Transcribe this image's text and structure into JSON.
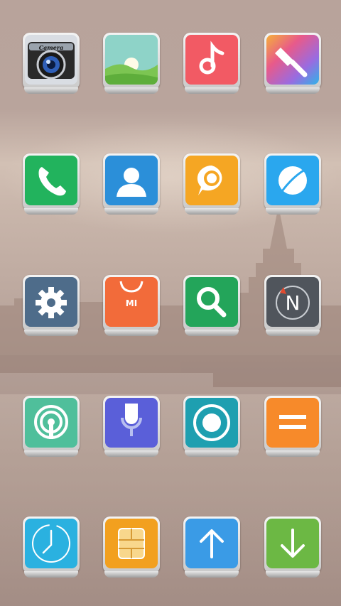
{
  "screen": {
    "apps": [
      {
        "icon": "camera-icon",
        "brand_text": "Camera",
        "color": "#2a2a2a"
      },
      {
        "icon": "gallery-icon",
        "color": "#8ed3c8"
      },
      {
        "icon": "music-icon",
        "color": "#f25a64"
      },
      {
        "icon": "themes-icon",
        "color": "#d46ad0"
      },
      {
        "icon": "phone-icon",
        "color": "#22b35d"
      },
      {
        "icon": "contacts-icon",
        "color": "#2b8fd9"
      },
      {
        "icon": "messages-icon",
        "color": "#f5a623"
      },
      {
        "icon": "browser-icon",
        "color": "#2aa7ee"
      },
      {
        "icon": "settings-icon",
        "color": "#4e6c8a"
      },
      {
        "icon": "mi-store-icon",
        "brand_text": "MI",
        "color": "#f26b3a"
      },
      {
        "icon": "search-icon",
        "color": "#23a55a"
      },
      {
        "icon": "compass-icon",
        "letter": "N",
        "color": "#50555c"
      },
      {
        "icon": "hotspot-icon",
        "color": "#4fbf9b"
      },
      {
        "icon": "voice-recorder-icon",
        "color": "#5a5fd9"
      },
      {
        "icon": "screen-recorder-icon",
        "color": "#1e9fb0"
      },
      {
        "icon": "calculator-icon",
        "color": "#f78a2a"
      },
      {
        "icon": "clock-icon",
        "color": "#2ab1e0"
      },
      {
        "icon": "sim-toolkit-icon",
        "color": "#f2a01f"
      },
      {
        "icon": "upload-icon",
        "color": "#3a9be6"
      },
      {
        "icon": "download-icon",
        "color": "#6cb844"
      }
    ]
  }
}
